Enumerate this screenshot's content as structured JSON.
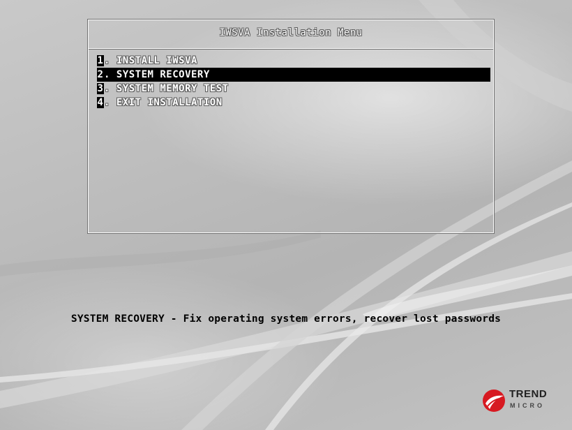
{
  "menu": {
    "title": "IWSVA  Installation Menu",
    "items": [
      {
        "number": "1",
        "label": ". INSTALL IWSVA",
        "selected": false
      },
      {
        "number": "2",
        "label": ". SYSTEM RECOVERY",
        "selected": true
      },
      {
        "number": "3",
        "label": ". SYSTEM MEMORY TEST",
        "selected": false
      },
      {
        "number": "4",
        "label": ". EXIT INSTALLATION",
        "selected": false
      }
    ]
  },
  "help_text": "SYSTEM RECOVERY - Fix operating system errors, recover lost passwords",
  "logo": {
    "brand_line1": "TREND",
    "brand_line2": "MICRO",
    "icon": "trend-micro-logo-icon"
  },
  "colors": {
    "background": "#c2c2c2",
    "selection": "#000000",
    "menu_text": "#ffffff",
    "help_text": "#000000",
    "logo_red": "#d71921"
  }
}
